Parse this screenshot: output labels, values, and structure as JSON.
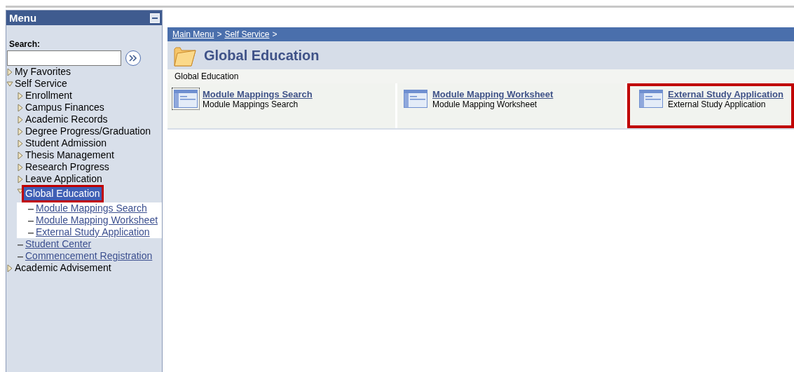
{
  "menu": {
    "title": "Menu",
    "search": {
      "label": "Search:"
    },
    "tree": [
      {
        "label": "My Favorites",
        "kind": "folder",
        "expanded": false,
        "selected": false,
        "highlighted": false
      },
      {
        "label": "Self Service",
        "kind": "folder",
        "expanded": true,
        "selected": false,
        "highlighted": false,
        "children": [
          {
            "label": "Enrollment",
            "kind": "folder",
            "expanded": false,
            "selected": false,
            "highlighted": false
          },
          {
            "label": "Campus Finances",
            "kind": "folder",
            "expanded": false,
            "selected": false,
            "highlighted": false
          },
          {
            "label": "Academic Records",
            "kind": "folder",
            "expanded": false,
            "selected": false,
            "highlighted": false
          },
          {
            "label": "Degree Progress/Graduation",
            "kind": "folder",
            "expanded": false,
            "selected": false,
            "highlighted": false
          },
          {
            "label": "Student Admission",
            "kind": "folder",
            "expanded": false,
            "selected": false,
            "highlighted": false
          },
          {
            "label": "Thesis Management",
            "kind": "folder",
            "expanded": false,
            "selected": false,
            "highlighted": false
          },
          {
            "label": "Research Progress",
            "kind": "folder",
            "expanded": false,
            "selected": false,
            "highlighted": false
          },
          {
            "label": "Leave Application",
            "kind": "folder",
            "expanded": false,
            "selected": false,
            "highlighted": false
          },
          {
            "label": "Global Education",
            "kind": "folder",
            "expanded": true,
            "selected": true,
            "highlighted": true,
            "children": [
              {
                "label": "Module Mappings Search",
                "kind": "link",
                "selected": false,
                "highlighted": false
              },
              {
                "label": "Module Mapping Worksheet",
                "kind": "link",
                "selected": false,
                "highlighted": false
              },
              {
                "label": "External Study Application",
                "kind": "link",
                "selected": false,
                "highlighted": false
              }
            ]
          },
          {
            "label": "Student Center",
            "kind": "link",
            "selected": false,
            "highlighted": false
          },
          {
            "label": "Commencement Registration",
            "kind": "link",
            "selected": false,
            "highlighted": false
          }
        ]
      },
      {
        "label": "Academic Advisement",
        "kind": "folder",
        "expanded": false,
        "selected": false,
        "highlighted": false
      }
    ]
  },
  "breadcrumb": [
    "Main Menu",
    "Self Service"
  ],
  "breadcrumb_separator": ">",
  "page": {
    "title": "Global Education",
    "subtitle": "Global Education",
    "tiles": [
      {
        "title": "Module Mappings Search",
        "description": "Module Mappings Search",
        "focused": true,
        "highlighted": false
      },
      {
        "title": "Module Mapping Worksheet",
        "description": "Module Mapping Worksheet",
        "focused": false,
        "highlighted": false
      },
      {
        "title": "External Study Application",
        "description": "External Study Application",
        "focused": false,
        "highlighted": true
      }
    ]
  }
}
